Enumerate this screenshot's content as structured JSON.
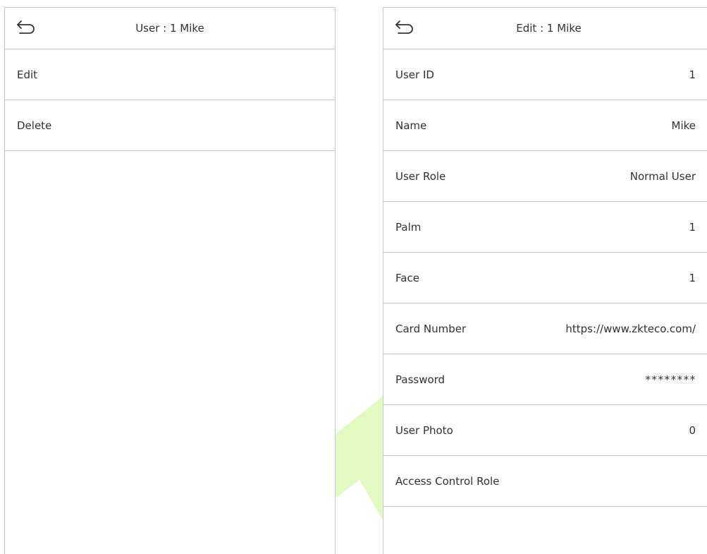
{
  "left_panel": {
    "title": "User : 1 Mike",
    "items": [
      {
        "label": "Edit"
      },
      {
        "label": "Delete"
      }
    ]
  },
  "right_panel": {
    "title": "Edit : 1 Mike",
    "fields": [
      {
        "label": "User ID",
        "value": "1"
      },
      {
        "label": "Name",
        "value": "Mike"
      },
      {
        "label": "User Role",
        "value": "Normal User"
      },
      {
        "label": "Palm",
        "value": "1"
      },
      {
        "label": "Face",
        "value": "1"
      },
      {
        "label": "Card Number",
        "value": "https://www.zkteco.com/"
      },
      {
        "label": "Password",
        "value": "********"
      },
      {
        "label": "User Photo",
        "value": "0"
      },
      {
        "label": "Access Control Role",
        "value": ""
      }
    ]
  },
  "icons": {
    "back": "back-arrow-icon"
  },
  "colors": {
    "border": "#c8c8c8",
    "text": "#333333",
    "watermark": "#c9f58a"
  }
}
